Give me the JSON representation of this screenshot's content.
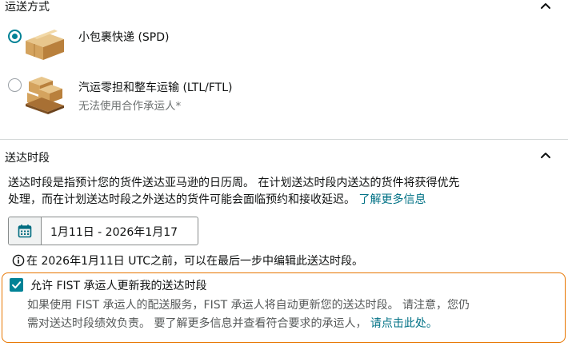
{
  "shipping_method": {
    "title": "运送方式",
    "options": [
      {
        "label": "小包裹快递 (SPD)",
        "selected": true
      },
      {
        "label": "汽运零担和整车运输 (LTL/FTL)",
        "sublabel": "无法使用合作承运人*",
        "selected": false
      }
    ]
  },
  "delivery_window": {
    "title": "送达时段",
    "desc_line1": "送达时段是指预计您的货件送达亚马逊的日历周。 在计划送达时段内送达的货件将获得优先",
    "desc_line2": "处理，而在计划送达时段之外送达的货件可能会面临预约和接收延迟。",
    "learn_more": "了解更多信息",
    "date_range": "1月11日 - 2026年1月17",
    "info_text": "在 2026年1月11日 UTC之前，可以在最后一步中编辑此送达时段。"
  },
  "fist": {
    "checkbox_label": "允许 FIST 承运人更新我的送达时段",
    "checked": true,
    "desc_line1": "如果使用 FIST 承运人的配送服务，FIST 承运人将自动更新您的送达时段。 请注意，您仍",
    "desc_line2": "需对送达时段绩效负责。 要了解更多信息并查看符合要求的承运人，",
    "link": "请点击此处。"
  },
  "colors": {
    "accent": "#008296",
    "link": "#007185",
    "highlight_border": "#e77600"
  }
}
